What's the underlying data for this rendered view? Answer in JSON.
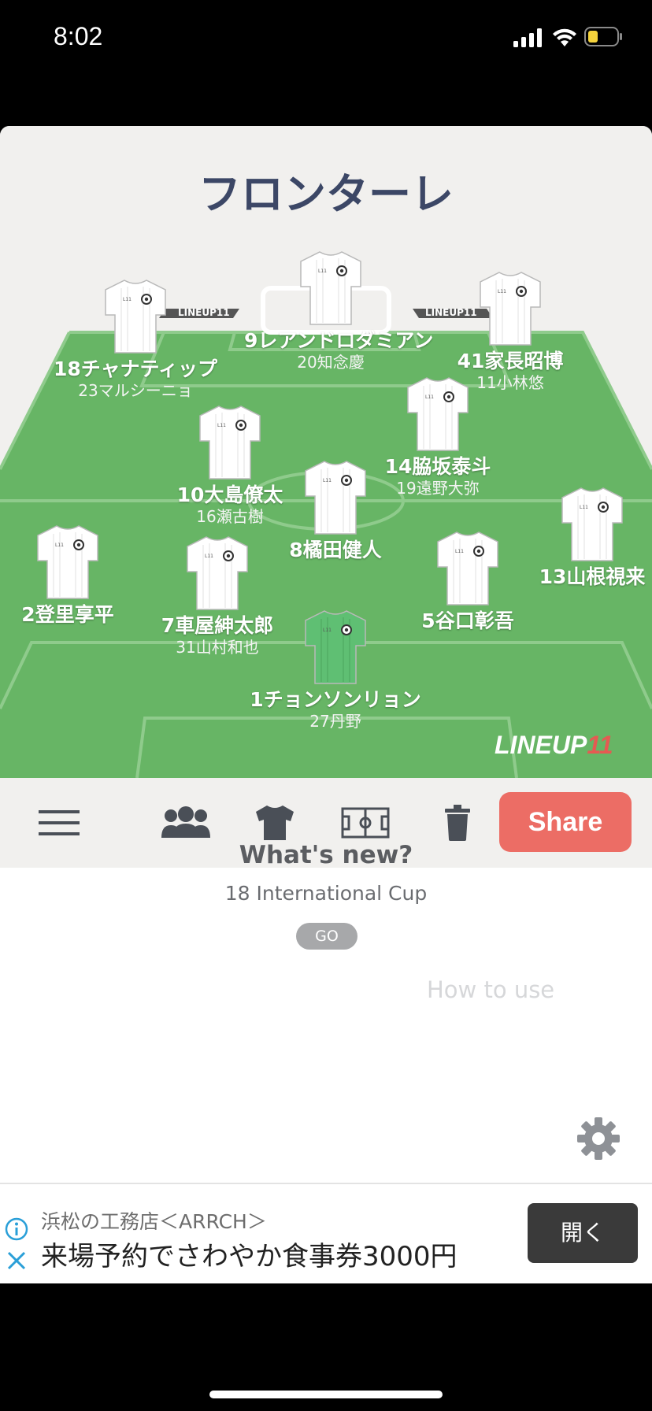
{
  "status_bar": {
    "time": "8:02"
  },
  "team": {
    "name": "フロンターレ"
  },
  "players": [
    {
      "number_name": "9レアンドロダミアン",
      "sub": "20知念慶",
      "keeper": false
    },
    {
      "number_name": "18チャナティップ",
      "sub": "23マルシーニョ",
      "keeper": false
    },
    {
      "number_name": "41家長昭博",
      "sub": "11小林悠",
      "keeper": false
    },
    {
      "number_name": "10大島僚太",
      "sub": "16瀬古樹",
      "keeper": false
    },
    {
      "number_name": "14脇坂泰斗",
      "sub": "19遠野大弥",
      "keeper": false
    },
    {
      "number_name": "8橘田健人",
      "sub": "",
      "keeper": false
    },
    {
      "number_name": "2登里享平",
      "sub": "",
      "keeper": false
    },
    {
      "number_name": "7車屋紳太郎",
      "sub": "31山村和也",
      "keeper": false
    },
    {
      "number_name": "5谷口彰吾",
      "sub": "",
      "keeper": false
    },
    {
      "number_name": "13山根視来",
      "sub": "",
      "keeper": false
    },
    {
      "number_name": "1チョンソンリョン",
      "sub": "27丹野",
      "keeper": true
    }
  ],
  "brand": {
    "logo_text": "LINEUP",
    "logo_num": "11",
    "board_text": "LINEUP11"
  },
  "toolbar": {
    "menu_icon": "hamburger-icon",
    "players_icon": "people-icon",
    "shirt_icon": "shirt-icon",
    "field_icon": "field-icon",
    "delete_icon": "trash-icon",
    "share_label": "Share"
  },
  "whats_new": {
    "title": "What's new?",
    "subtitle": "18 International Cup",
    "go_label": "GO"
  },
  "how_to_use": {
    "label": "How to use",
    "icon": "gear-icon"
  },
  "ad": {
    "line1": "浜松の工務店＜ARRCH＞",
    "line2": "来場予約でさわやか食事券3000円",
    "open_label": "開く",
    "info_icon": "info-icon",
    "close_icon": "close-icon"
  },
  "colors": {
    "field": "#67b565",
    "field_lines": "#8fcb8c",
    "title": "#3c4766",
    "share": "#ec6d65",
    "keeper_shirt": "#5fbf73",
    "logo_accent": "#e55a52"
  }
}
